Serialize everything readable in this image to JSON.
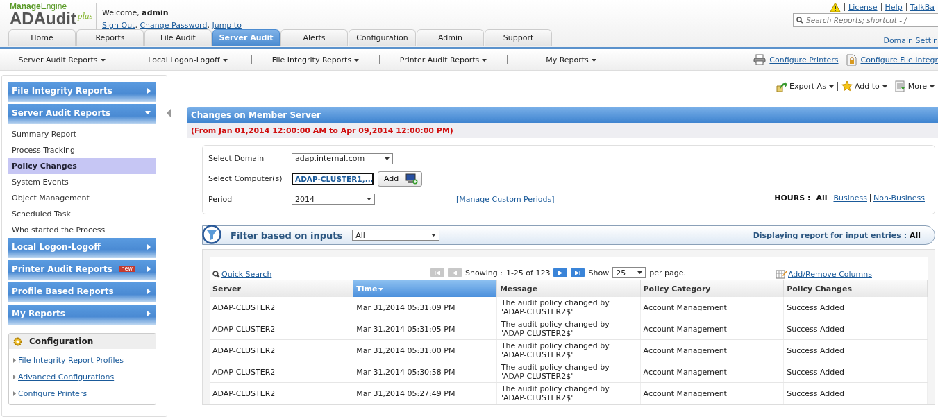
{
  "header": {
    "logo": {
      "brand": "**Manage**Engine",
      "product": "ADAudit",
      "suffix": "plus"
    },
    "welcome": "Welcome, **admin**",
    "account_links": [
      {
        "label": "Sign Out",
        "after": ","
      },
      {
        "label": "Change Password",
        "after": ","
      },
      {
        "label": "Jump to"
      }
    ],
    "top_links": [
      "License",
      "Help",
      "TalkBa"
    ],
    "search": {
      "placeholder": "Search Reports; shortcut - /"
    },
    "tabs": [
      {
        "label": "Home",
        "selected": false
      },
      {
        "label": "Reports",
        "selected": false
      },
      {
        "label": "File Audit",
        "selected": false
      },
      {
        "label": "Server Audit",
        "selected": true
      },
      {
        "label": "Alerts",
        "selected": false
      },
      {
        "label": "Configuration",
        "selected": false
      },
      {
        "label": "Admin",
        "selected": false
      },
      {
        "label": "Support",
        "selected": false
      }
    ],
    "domain_link": "Domain Settin"
  },
  "subnav": {
    "menus": [
      "Server Audit Reports",
      "Local Logon-Logoff",
      "File Integrity Reports",
      "Printer Audit Reports",
      "My Reports"
    ],
    "links": [
      {
        "label": "Configure Printers",
        "kind": "printer"
      },
      {
        "label": "Configure File Integr",
        "kind": "lockfile"
      }
    ]
  },
  "sidebar": {
    "sections": [
      {
        "title": "File Integrity Reports",
        "expanded": false
      },
      {
        "title": "Server Audit Reports",
        "expanded": true,
        "items": [
          {
            "label": "Summary Report",
            "selected": false
          },
          {
            "label": "Process Tracking",
            "selected": false
          },
          {
            "label": "Policy Changes",
            "selected": true
          },
          {
            "label": "System Events",
            "selected": false
          },
          {
            "label": "Object Management",
            "selected": false
          },
          {
            "label": "Scheduled Task",
            "selected": false
          },
          {
            "label": "Who started the Process",
            "selected": false
          }
        ]
      },
      {
        "title": "Local Logon-Logoff",
        "expanded": false
      },
      {
        "title": "Printer Audit Reports",
        "expanded": false,
        "badge": "new"
      },
      {
        "title": "Profile Based Reports",
        "expanded": false
      },
      {
        "title": "My Reports",
        "expanded": false
      }
    ],
    "configuration": {
      "title": "Configuration",
      "links": [
        "File Integrity Report Profiles",
        "Advanced Configurations",
        "Configure Printers"
      ]
    }
  },
  "toolbar": [
    {
      "label": "Export As",
      "kind": "export"
    },
    {
      "label": "Add to",
      "kind": "star"
    },
    {
      "label": "More",
      "kind": "more"
    }
  ],
  "report": {
    "title": "Changes on Member Server",
    "range": "(From Jan 01,2014 12:00:00 AM to Apr 09,2014 12:00:00 PM)",
    "form": {
      "domain_label": "Select Domain",
      "domain": "adap.internal.com",
      "computers_label": "Select Computer(s)",
      "computers": "ADAP-CLUSTER1,...",
      "add_button": "Add",
      "period_label": "Period",
      "period": "2014",
      "manage_link": "[Manage Custom Periods]",
      "hours_label": "HOURS :",
      "hours": [
        {
          "label": "All",
          "selected": true
        },
        {
          "label": "Business ",
          "selected": false
        },
        {
          "label": "Non-Business ",
          "selected": false
        }
      ]
    },
    "filter": {
      "label": "Filter based on inputs",
      "value": "All",
      "display_label": "Displaying report for input entries :",
      "display_value": "All"
    },
    "table_tools": {
      "quick_search": "Quick Search",
      "showing": "Showing :",
      "range": "1-25 of 123",
      "show": "Show",
      "page_size": "25",
      "per_page": "per page.",
      "columns_link": "Add/Remove Columns"
    },
    "table": {
      "columns": [
        {
          "label": "Server",
          "sorted": false
        },
        {
          "label": "Time",
          "sorted": true
        },
        {
          "label": "Message",
          "sorted": false
        },
        {
          "label": "Policy Category",
          "sorted": false
        },
        {
          "label": "Policy Changes",
          "sorted": false
        }
      ],
      "rows": [
        [
          "ADAP-CLUSTER2",
          "Mar 31,2014 05:31:09 PM",
          "The audit policy changed by 'ADAP-CLUSTER2$'",
          "Account Management",
          "Success Added"
        ],
        [
          "ADAP-CLUSTER2",
          "Mar 31,2014 05:31:05 PM",
          "The audit policy changed by 'ADAP-CLUSTER2$'",
          "Account Management",
          "Success Added"
        ],
        [
          "ADAP-CLUSTER2",
          "Mar 31,2014 05:31:00 PM",
          "The audit policy changed by 'ADAP-CLUSTER2$'",
          "Account Management",
          "Success Added"
        ],
        [
          "ADAP-CLUSTER2",
          "Mar 31,2014 05:30:58 PM",
          "The audit policy changed by 'ADAP-CLUSTER2$'",
          "Account Management",
          "Success Added"
        ],
        [
          "ADAP-CLUSTER2",
          "Mar 31,2014 05:27:49 PM",
          "The audit policy changed by 'ADAP-CLUSTER2$'",
          "Account Management",
          "Success Added"
        ]
      ]
    }
  }
}
